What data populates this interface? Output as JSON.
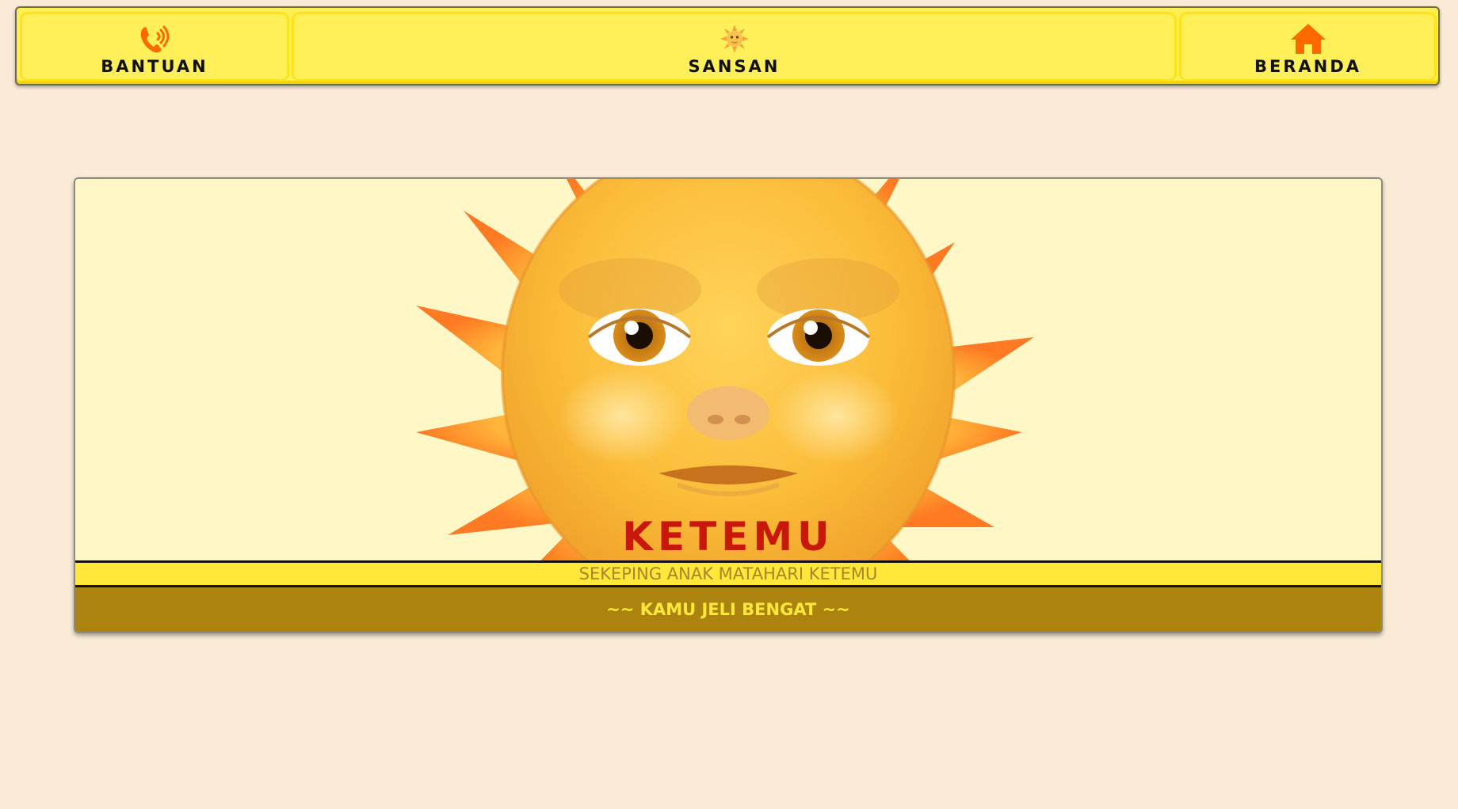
{
  "nav": {
    "help": {
      "label": "BANTUAN",
      "icon": "phone-ringing-icon",
      "icon_color": "#ff6a00"
    },
    "center": {
      "label": "SANSAN",
      "icon": "sun-face-icon"
    },
    "home": {
      "label": "BERANDA",
      "icon": "home-icon",
      "icon_color": "#ff6a00"
    }
  },
  "card": {
    "image": "sun-with-face",
    "title": "KETEMU",
    "subtitle": "SEKEPING ANAK MATAHARI KETEMU",
    "footer": "~~ KAMU JELI BENGAT ~~"
  },
  "colors": {
    "page_background": "#faebd7",
    "nav_background": "#ffef55",
    "card_background": "#fff8c6",
    "title": "#c8180a",
    "subtitle_bar": "#ffe83a",
    "subtitle_text": "#a8852a",
    "footer_bar": "#ad8310",
    "footer_text": "#ffe83a"
  }
}
